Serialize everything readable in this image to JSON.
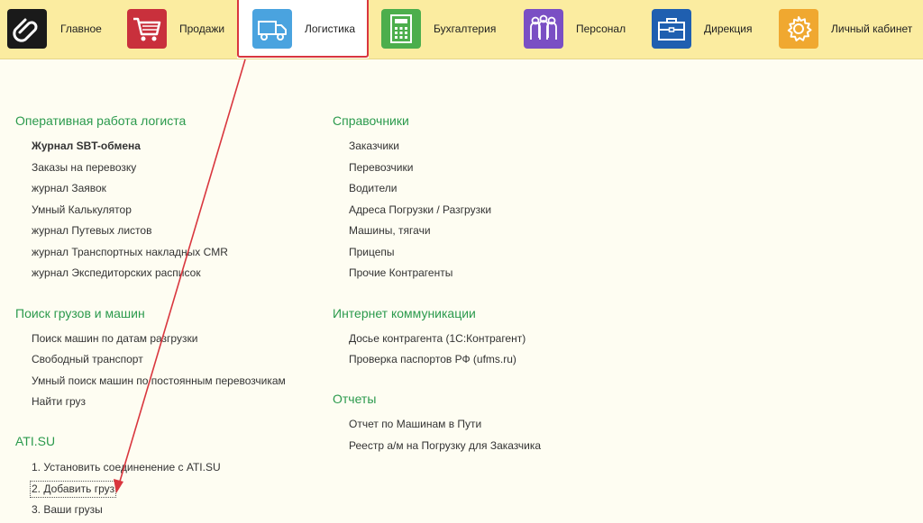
{
  "nav": {
    "items": [
      {
        "label": "Главное"
      },
      {
        "label": "Продажи"
      },
      {
        "label": "Логистика"
      },
      {
        "label": "Бухгалтерия"
      },
      {
        "label": "Персонал"
      },
      {
        "label": "Дирекция"
      },
      {
        "label": "Личный кабинет"
      }
    ],
    "active_item": "Логистика"
  },
  "left": {
    "operative": {
      "title": "Оперативная работа логиста",
      "links": [
        "Журнал SBT-обмена",
        "Заказы на перевозку",
        "журнал Заявок",
        "Умный Калькулятор",
        "журнал Путевых листов",
        "журнал Транспортных накладных CMR",
        "журнал Экспедиторских расписок"
      ]
    },
    "search": {
      "title": "Поиск грузов и машин",
      "links": [
        "Поиск машин по датам разгрузки",
        "Свободный транспорт",
        "Умный поиск машин по постоянным перевозчикам",
        "Найти груз"
      ]
    },
    "ati": {
      "title": "ATI.SU",
      "links": [
        "1. Установить соединенение с ATI.SU",
        "2. Добавить груз",
        "3. Ваши грузы"
      ]
    }
  },
  "right": {
    "refs": {
      "title": "Справочники",
      "links": [
        "Заказчики",
        "Перевозчики",
        "Водители",
        "Адреса Погрузки / Разгрузки",
        "Машины, тягачи",
        "Прицепы",
        "Прочие Контрагенты"
      ]
    },
    "internet": {
      "title": "Интернет коммуникации",
      "links": [
        "Досье контрагента (1С:Контрагент)",
        "Проверка паспортов РФ (ufms.ru)"
      ]
    },
    "reports": {
      "title": "Отчеты",
      "links": [
        "Отчет по Машинам в Пути",
        "Реестр а/м на Погрузку для Заказчика"
      ]
    }
  },
  "colors": {
    "topbar": "#fbeca0",
    "section_title": "#2b9a4d",
    "highlight_red": "#d9363e",
    "icon_main": "#1a1a1a",
    "icon_sales": "#c9303c",
    "icon_logistics": "#4aa3df",
    "icon_accounting": "#4cae4c",
    "icon_staff": "#7a4fc4",
    "icon_direction": "#1f5fb0",
    "icon_cabinet": "#f0a830"
  },
  "icons": [
    "paperclip-icon",
    "shopping-cart-icon",
    "truck-icon",
    "calculator-icon",
    "people-icon",
    "briefcase-icon",
    "gear-icon"
  ]
}
